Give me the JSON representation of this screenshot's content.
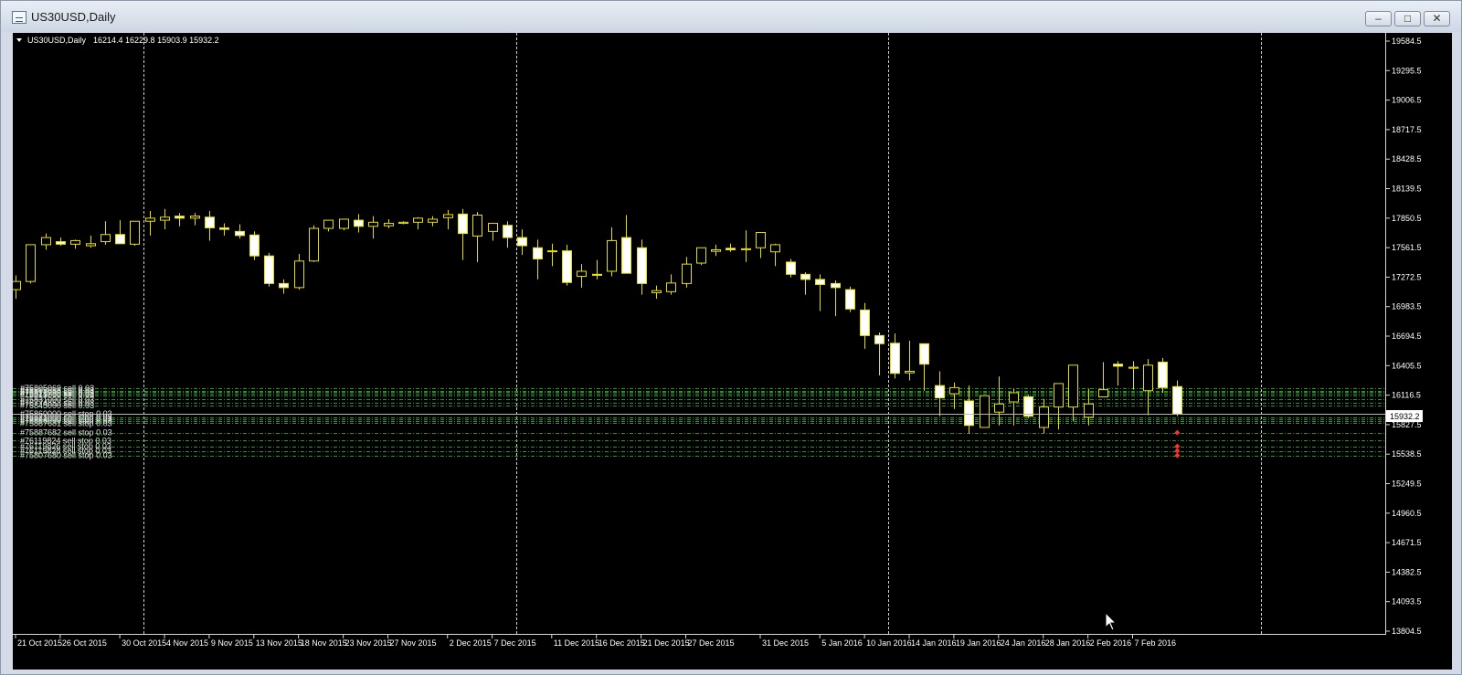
{
  "window": {
    "title": "US30USD,Daily",
    "controls": [
      "minimize",
      "maximize",
      "close"
    ]
  },
  "chart_info": {
    "symbol": "US30USD,Daily",
    "ohlc": "16214.4 16229.8 15903.9 15932.2"
  },
  "price_labels": [
    "19584.5",
    "19295.5",
    "19006.5",
    "18717.5",
    "18428.5",
    "18139.5",
    "17850.5",
    "17561.5",
    "17272.5",
    "16983.5",
    "16694.5",
    "16405.5",
    "16116.5",
    "15827.5",
    "15538.5",
    "15249.5",
    "14960.5",
    "14671.5",
    "14382.5",
    "14093.5",
    "13804.5"
  ],
  "current_price": "15932.2",
  "date_labels": [
    "21 Oct 2015",
    "26 Oct 2015",
    "30 Oct 2015",
    "4 Nov 2015",
    "9 Nov 2015",
    "13 Nov 2015",
    "18 Nov 2015",
    "23 Nov 2015",
    "27 Nov 2015",
    "2 Dec 2015",
    "7 Dec 2015",
    "11 Dec 2015",
    "16 Dec 2015",
    "21 Dec 2015",
    "27 Dec 2015",
    "31 Dec 2015",
    "5 Jan 2016",
    "10 Jan 2016",
    "14 Jan 2016",
    "19 Jan 2016",
    "24 Jan 2016",
    "28 Jan 2016",
    "2 Feb 2016",
    "7 Feb 2016"
  ],
  "order_lines": [
    {
      "label": "#75805069 sell 0.03",
      "price": 16186
    },
    {
      "label": "#75805066 sell 0.03",
      "price": 16160
    },
    {
      "label": "#75812000 sell 0.03",
      "price": 16146
    },
    {
      "label": "#75821785 sell 0.03",
      "price": 16131
    },
    {
      "label": "#75813000 sell 0.03",
      "price": 16117
    },
    {
      "label": "#75831000 sell 0.03",
      "price": 16074
    },
    {
      "label": "#76774853 sell 0.03",
      "price": 16040
    },
    {
      "label": "#75845000 sell 0.03",
      "price": 16015
    },
    {
      "label": "#75860000 sell stop 0.03",
      "price": 15932
    },
    {
      "label": "#75871000 sell stop 0.03",
      "price": 15902
    },
    {
      "label": "#75882000 sell stop 0.03",
      "price": 15883
    },
    {
      "label": "#75886000 sell stop 0.03",
      "price": 15866
    },
    {
      "label": "#75887681 sell stop 0.03",
      "price": 15841
    },
    {
      "label": "#75887682 sell stop 0.03",
      "price": 15749
    },
    {
      "label": "#76119824 sell stop 0.03",
      "price": 15672
    },
    {
      "label": "#76119826 sell stop 0.03",
      "price": 15615
    },
    {
      "label": "#76119828 sell stop 0.03",
      "price": 15570
    },
    {
      "label": "#75807680 sell stop 0.03",
      "price": 15526
    }
  ],
  "chart_data": {
    "type": "candlestick",
    "title": "US30USD,Daily",
    "ylim": [
      13804.5,
      19584.5
    ],
    "x": [
      "2015-10-21",
      "2015-10-22",
      "2015-10-23",
      "2015-10-26",
      "2015-10-27",
      "2015-10-28",
      "2015-10-29",
      "2015-10-30",
      "2015-11-02",
      "2015-11-03",
      "2015-11-04",
      "2015-11-05",
      "2015-11-06",
      "2015-11-09",
      "2015-11-10",
      "2015-11-11",
      "2015-11-12",
      "2015-11-13",
      "2015-11-16",
      "2015-11-17",
      "2015-11-18",
      "2015-11-19",
      "2015-11-20",
      "2015-11-23",
      "2015-11-24",
      "2015-11-25",
      "2015-11-26",
      "2015-11-27",
      "2015-11-30",
      "2015-12-01",
      "2015-12-02",
      "2015-12-03",
      "2015-12-04",
      "2015-12-07",
      "2015-12-08",
      "2015-12-09",
      "2015-12-10",
      "2015-12-11",
      "2015-12-14",
      "2015-12-15",
      "2015-12-16",
      "2015-12-17",
      "2015-12-18",
      "2015-12-21",
      "2015-12-22",
      "2015-12-23",
      "2015-12-24",
      "2015-12-25",
      "2015-12-28",
      "2015-12-29",
      "2015-12-30",
      "2015-12-31",
      "2016-01-04",
      "2016-01-05",
      "2016-01-06",
      "2016-01-07",
      "2016-01-08",
      "2016-01-11",
      "2016-01-12",
      "2016-01-13",
      "2016-01-14",
      "2016-01-15",
      "2016-01-18",
      "2016-01-19",
      "2016-01-20",
      "2016-01-21",
      "2016-01-22",
      "2016-01-25",
      "2016-01-26",
      "2016-01-27",
      "2016-01-28",
      "2016-01-29",
      "2016-02-01",
      "2016-02-02",
      "2016-02-03",
      "2016-02-04",
      "2016-02-05",
      "2016-02-08",
      "2016-02-09"
    ],
    "open": [
      17150,
      17230,
      17590,
      17620,
      17595,
      17580,
      17620,
      17690,
      17595,
      17820,
      17830,
      17870,
      17850,
      17860,
      17755,
      17720,
      17685,
      17480,
      17210,
      17170,
      17430,
      17750,
      17750,
      17830,
      17770,
      17775,
      17800,
      17810,
      17810,
      17855,
      17890,
      17675,
      17720,
      17780,
      17660,
      17560,
      17530,
      17530,
      17280,
      17300,
      17330,
      17660,
      17560,
      17120,
      17130,
      17210,
      17410,
      17525,
      17555,
      17550,
      17560,
      17520,
      17420,
      17300,
      17250,
      17210,
      17150,
      16950,
      16700,
      16625,
      16335,
      16620,
      16210,
      16130,
      16060,
      15800,
      15950,
      16050,
      16100,
      15800,
      16000,
      16000,
      15900,
      16100,
      16420,
      16380,
      16160,
      16440,
      16200
    ],
    "high": [
      17290,
      17580,
      17700,
      17660,
      17640,
      17680,
      17820,
      17830,
      17720,
      17920,
      17940,
      17900,
      17900,
      17920,
      17800,
      17790,
      17720,
      17510,
      17250,
      17500,
      17780,
      17830,
      17830,
      17890,
      17870,
      17840,
      17820,
      17860,
      17870,
      17930,
      17940,
      17910,
      17760,
      17820,
      17740,
      17640,
      17600,
      17590,
      17400,
      17440,
      17760,
      17880,
      17640,
      17190,
      17300,
      17470,
      17560,
      17590,
      17600,
      17730,
      17630,
      17600,
      17450,
      17320,
      17300,
      17240,
      17180,
      17020,
      16730,
      16720,
      16650,
      16620,
      16350,
      16240,
      16210,
      15950,
      16300,
      16180,
      16120,
      16080,
      16150,
      16200,
      16180,
      16440,
      16450,
      16450,
      16470,
      16480,
      16260
    ],
    "low": [
      17060,
      17210,
      17540,
      17580,
      17550,
      17560,
      17590,
      17600,
      17580,
      17680,
      17740,
      17770,
      17780,
      17630,
      17680,
      17650,
      17440,
      17180,
      17110,
      17150,
      17420,
      17720,
      17730,
      17710,
      17650,
      17750,
      17790,
      17740,
      17770,
      17740,
      17440,
      17420,
      17630,
      17560,
      17490,
      17250,
      17380,
      17190,
      17170,
      17250,
      17280,
      17450,
      17100,
      17060,
      17100,
      17170,
      17390,
      17480,
      17520,
      17420,
      17460,
      17380,
      17270,
      17100,
      16940,
      16890,
      16930,
      16570,
      16310,
      16280,
      16260,
      16160,
      15910,
      15980,
      15740,
      15800,
      15820,
      15820,
      15890,
      15740,
      15780,
      15860,
      15820,
      16100,
      16210,
      16170,
      15920,
      16140,
      15910
    ],
    "close": [
      17230,
      17590,
      17660,
      17595,
      17630,
      17600,
      17690,
      17600,
      17820,
      17850,
      17860,
      17850,
      17870,
      17755,
      17740,
      17680,
      17480,
      17210,
      17170,
      17430,
      17750,
      17830,
      17840,
      17770,
      17810,
      17800,
      17810,
      17850,
      17840,
      17885,
      17700,
      17880,
      17800,
      17660,
      17580,
      17450,
      17530,
      17220,
      17330,
      17290,
      17630,
      17310,
      17210,
      17140,
      17215,
      17400,
      17560,
      17540,
      17540,
      17550,
      17710,
      17590,
      17300,
      17250,
      17200,
      17170,
      16960,
      16700,
      16620,
      16330,
      16350,
      16420,
      16090,
      16190,
      15820,
      16110,
      16030,
      16140,
      15910,
      16000,
      16230,
      16410,
      16030,
      16170,
      16400,
      16390,
      16410,
      16190,
      15932
    ]
  }
}
